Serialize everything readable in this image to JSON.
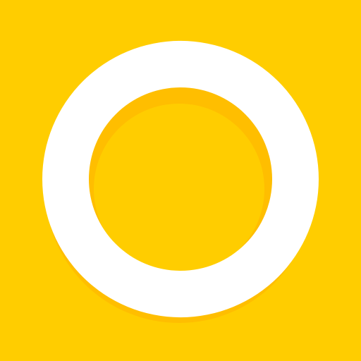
{
  "icon": {
    "name": "ring-logo-icon",
    "background_color": "#FFCD00",
    "ring_color": "#FFFFFF",
    "shadow_color": "#FFBE00"
  }
}
